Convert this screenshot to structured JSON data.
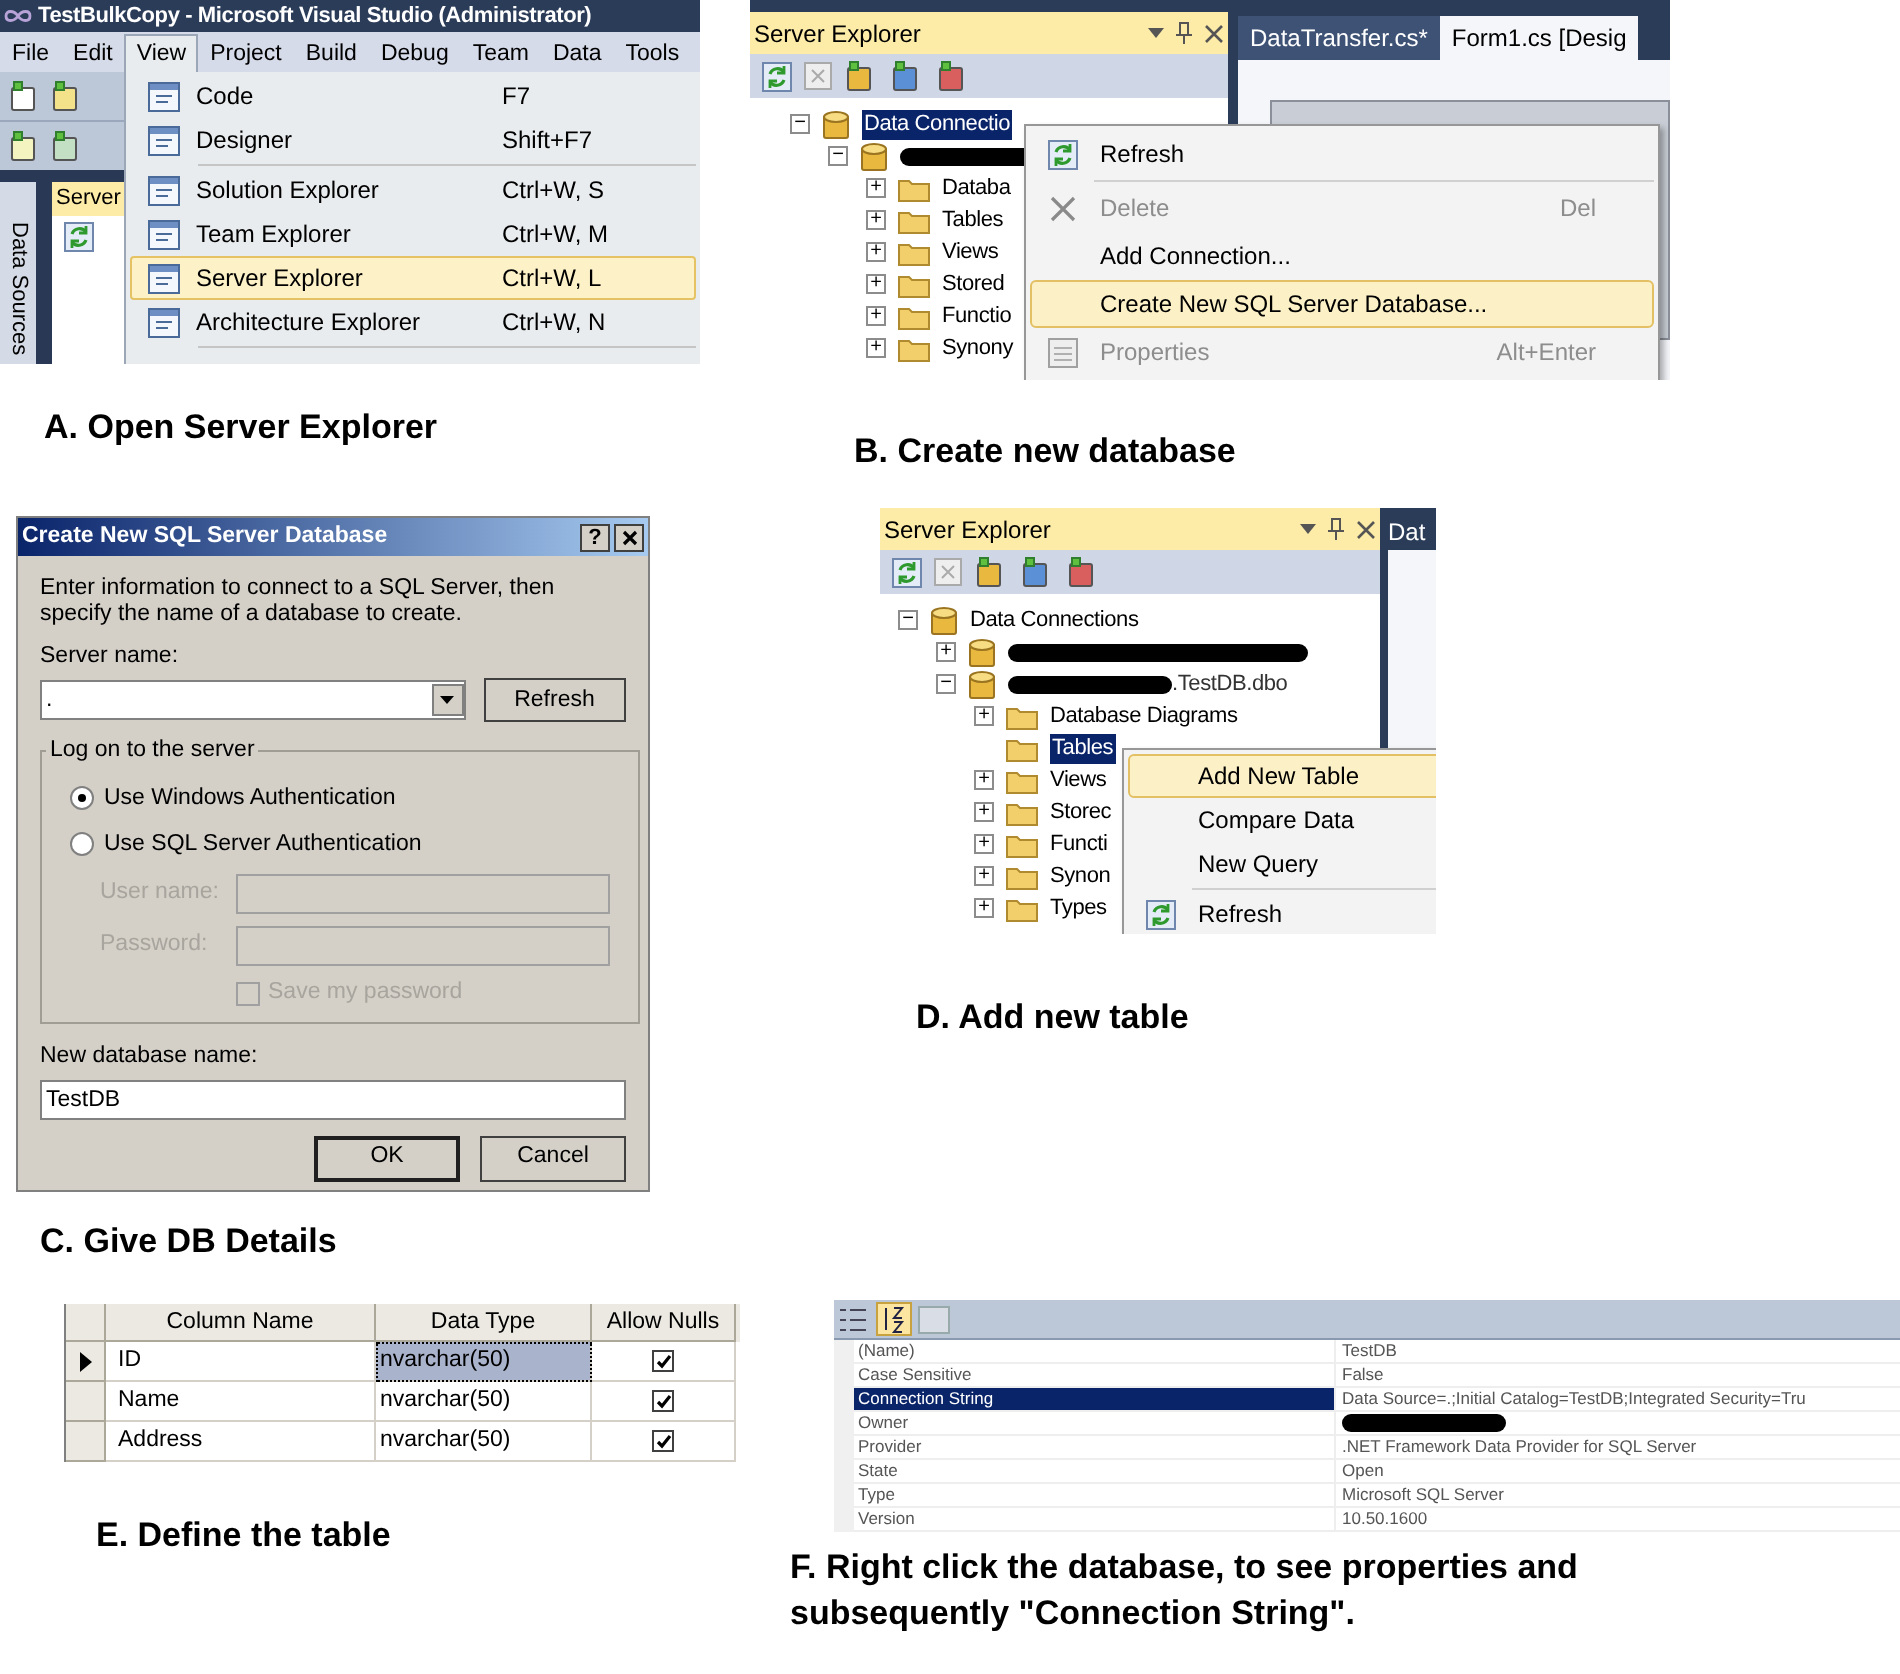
{
  "view_menu_shot": {
    "window_title": "TestBulkCopy - Microsoft Visual Studio (Administrator)",
    "menubar": [
      {
        "label": "File",
        "selected": false
      },
      {
        "label": "Edit",
        "selected": false
      },
      {
        "label": "View",
        "selected": true
      },
      {
        "label": "Project",
        "selected": false
      },
      {
        "label": "Build",
        "selected": false
      },
      {
        "label": "Debug",
        "selected": false
      },
      {
        "label": "Team",
        "selected": false
      },
      {
        "label": "Data",
        "selected": false
      },
      {
        "label": "Tools",
        "selected": false
      }
    ],
    "side_tab": "Data Sources",
    "panel_tab": "Server",
    "items": [
      {
        "kind": "item",
        "label": "Code",
        "shortcut": "F7",
        "selected": false
      },
      {
        "kind": "item",
        "label": "Designer",
        "shortcut": "Shift+F7",
        "selected": false
      },
      {
        "kind": "separator"
      },
      {
        "kind": "item",
        "label": "Solution Explorer",
        "shortcut": "Ctrl+W, S",
        "selected": false
      },
      {
        "kind": "item",
        "label": "Team Explorer",
        "shortcut": "Ctrl+W, M",
        "selected": false
      },
      {
        "kind": "item",
        "label": "Server Explorer",
        "shortcut": "Ctrl+W, L",
        "selected": true
      },
      {
        "kind": "item",
        "label": "Architecture Explorer",
        "shortcut": "Ctrl+W, N",
        "selected": false
      },
      {
        "kind": "separator"
      }
    ],
    "caption": "A. Open Server Explorer"
  },
  "server_explorer_shot": {
    "panel_title": "Server Explorer",
    "doc_tabs": [
      {
        "label": "DataTransfer.cs*",
        "selected": false
      },
      {
        "label": "Form1.cs [Desig",
        "selected": true
      }
    ],
    "tree": [
      {
        "kind": "connections",
        "label": "Data Connectio",
        "toggle": "−",
        "selected": true,
        "redacted": false,
        "children": [
          {
            "kind": "server",
            "toggle": "−",
            "redacted": true,
            "children": [
              {
                "kind": "folder",
                "label": "Databa",
                "toggle": "+",
                "selected": false,
                "redacted": false
              },
              {
                "kind": "folder",
                "label": "Tables",
                "toggle": "+",
                "selected": false,
                "redacted": false
              },
              {
                "kind": "folder",
                "label": "Views",
                "toggle": "+",
                "selected": false,
                "redacted": false
              },
              {
                "kind": "folder",
                "label": "Stored",
                "toggle": "+",
                "selected": false,
                "redacted": false
              },
              {
                "kind": "folder",
                "label": "Functio",
                "toggle": "+",
                "selected": false,
                "redacted": false
              },
              {
                "kind": "folder",
                "label": "Synony",
                "toggle": "+",
                "selected": false,
                "redacted": false
              }
            ]
          }
        ]
      }
    ],
    "menu": [
      {
        "kind": "refresh",
        "label": "Refresh",
        "disabled": false,
        "selected": false
      },
      {
        "kind": "separator"
      },
      {
        "kind": "delete",
        "label": "Delete",
        "shortcut": "Del",
        "disabled": true,
        "selected": false
      },
      {
        "kind": "plain",
        "label": "Add Connection...",
        "disabled": false,
        "selected": false
      },
      {
        "kind": "plain",
        "label": "Create New SQL Server Database...",
        "disabled": false,
        "selected": true
      },
      {
        "kind": "properties",
        "label": "Properties",
        "shortcut": "Alt+Enter",
        "disabled": true,
        "selected": false
      }
    ],
    "caption": "B. Create new database"
  },
  "create_db_dialog": {
    "title": "Create New SQL Server Database",
    "help_button": "?",
    "intro": "Enter information to connect to a SQL Server, then specify the name of a database to create.",
    "server_label": "Server name:",
    "server_value": ".",
    "refresh_button": "Refresh",
    "group_label": "Log on to the server",
    "auth_options": [
      {
        "label": "Use Windows Authentication",
        "selected": true
      },
      {
        "label": "Use SQL Server Authentication",
        "selected": false
      }
    ],
    "user_label": "User name:",
    "password_label": "Password:",
    "credentials_disabled": true,
    "save_password": {
      "label": "Save my password",
      "checked": false
    },
    "db_name_label": "New database name:",
    "db_name_value": "TestDB",
    "buttons": [
      "OK",
      "Cancel"
    ],
    "caption": "C. Give DB Details"
  },
  "add_table_shot": {
    "panel_title": "Server Explorer",
    "doc_tab": "Dat",
    "tree": [
      {
        "kind": "connections",
        "label": "Data Connections",
        "toggle": "−",
        "selected": false,
        "redacted": false,
        "children": [
          {
            "kind": "server",
            "toggle": "+",
            "redacted": true
          },
          {
            "kind": "server",
            "label": ".TestDB.dbo",
            "toggle": "−",
            "selected": false,
            "redacted": true,
            "children": [
              {
                "kind": "folder",
                "label": "Database Diagrams",
                "toggle": "+",
                "selected": false,
                "redacted": false
              },
              {
                "kind": "folder",
                "label": "Tables",
                "selected": true,
                "redacted": false
              },
              {
                "kind": "folder",
                "label": "Views",
                "toggle": "+",
                "selected": false,
                "redacted": false
              },
              {
                "kind": "folder",
                "label": "Storec",
                "toggle": "+",
                "selected": false,
                "redacted": false
              },
              {
                "kind": "folder",
                "label": "Functi",
                "toggle": "+",
                "selected": false,
                "redacted": false
              },
              {
                "kind": "folder",
                "label": "Synon",
                "toggle": "+",
                "selected": false,
                "redacted": false
              },
              {
                "kind": "folder",
                "label": "Types",
                "toggle": "+",
                "selected": false,
                "redacted": false
              }
            ]
          }
        ]
      }
    ],
    "menu": [
      {
        "kind": "plain",
        "label": "Add New Table",
        "disabled": false,
        "selected": true
      },
      {
        "kind": "plain",
        "label": "Compare Data",
        "disabled": false,
        "selected": false
      },
      {
        "kind": "plain",
        "label": "New Query",
        "disabled": false,
        "selected": false
      },
      {
        "kind": "separator"
      },
      {
        "kind": "refresh",
        "label": "Refresh",
        "disabled": false,
        "selected": false
      }
    ],
    "caption": "D. Add new table"
  },
  "table_designer": {
    "columns": [
      "Column Name",
      "Data Type",
      "Allow Nulls"
    ],
    "rows": [
      {
        "name": "ID",
        "data_type": "nvarchar(50)",
        "allow_nulls": true,
        "current": true
      },
      {
        "name": "Name",
        "data_type": "nvarchar(50)",
        "allow_nulls": true,
        "current": false
      },
      {
        "name": "Address",
        "data_type": "nvarchar(50)",
        "allow_nulls": true,
        "current": false
      }
    ],
    "caption": "E. Define the table"
  },
  "properties_grid": {
    "rows": [
      {
        "name": "(Name)",
        "value": "TestDB",
        "selected": false,
        "redacted": false
      },
      {
        "name": "Case Sensitive",
        "value": "False",
        "selected": false,
        "redacted": false
      },
      {
        "name": "Connection String",
        "value": "Data Source=.;Initial Catalog=TestDB;Integrated Security=Tru",
        "selected": true,
        "redacted": false
      },
      {
        "name": "Owner",
        "selected": false,
        "redacted": true
      },
      {
        "name": "Provider",
        "value": ".NET Framework Data Provider for SQL Server",
        "selected": false,
        "redacted": false
      },
      {
        "name": "State",
        "value": "Open",
        "selected": false,
        "redacted": false
      },
      {
        "name": "Type",
        "value": "Microsoft SQL Server",
        "selected": false,
        "redacted": false
      },
      {
        "name": "Version",
        "value": "10.50.1600",
        "selected": false,
        "redacted": false
      }
    ],
    "caption": "F. Right click the database, to see properties and subsequently \"Connection String\"."
  }
}
